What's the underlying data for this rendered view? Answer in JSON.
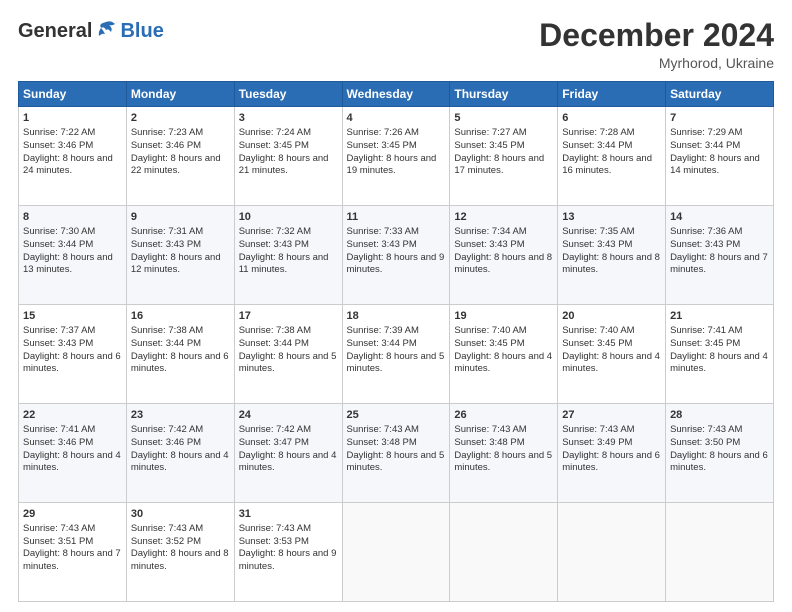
{
  "logo": {
    "general": "General",
    "blue": "Blue"
  },
  "header": {
    "month_title": "December 2024",
    "subtitle": "Myrhorod, Ukraine"
  },
  "calendar": {
    "days_of_week": [
      "Sunday",
      "Monday",
      "Tuesday",
      "Wednesday",
      "Thursday",
      "Friday",
      "Saturday"
    ],
    "weeks": [
      [
        {
          "day": "1",
          "sunrise": "Sunrise: 7:22 AM",
          "sunset": "Sunset: 3:46 PM",
          "daylight": "Daylight: 8 hours and 24 minutes."
        },
        {
          "day": "2",
          "sunrise": "Sunrise: 7:23 AM",
          "sunset": "Sunset: 3:46 PM",
          "daylight": "Daylight: 8 hours and 22 minutes."
        },
        {
          "day": "3",
          "sunrise": "Sunrise: 7:24 AM",
          "sunset": "Sunset: 3:45 PM",
          "daylight": "Daylight: 8 hours and 21 minutes."
        },
        {
          "day": "4",
          "sunrise": "Sunrise: 7:26 AM",
          "sunset": "Sunset: 3:45 PM",
          "daylight": "Daylight: 8 hours and 19 minutes."
        },
        {
          "day": "5",
          "sunrise": "Sunrise: 7:27 AM",
          "sunset": "Sunset: 3:45 PM",
          "daylight": "Daylight: 8 hours and 17 minutes."
        },
        {
          "day": "6",
          "sunrise": "Sunrise: 7:28 AM",
          "sunset": "Sunset: 3:44 PM",
          "daylight": "Daylight: 8 hours and 16 minutes."
        },
        {
          "day": "7",
          "sunrise": "Sunrise: 7:29 AM",
          "sunset": "Sunset: 3:44 PM",
          "daylight": "Daylight: 8 hours and 14 minutes."
        }
      ],
      [
        {
          "day": "8",
          "sunrise": "Sunrise: 7:30 AM",
          "sunset": "Sunset: 3:44 PM",
          "daylight": "Daylight: 8 hours and 13 minutes."
        },
        {
          "day": "9",
          "sunrise": "Sunrise: 7:31 AM",
          "sunset": "Sunset: 3:43 PM",
          "daylight": "Daylight: 8 hours and 12 minutes."
        },
        {
          "day": "10",
          "sunrise": "Sunrise: 7:32 AM",
          "sunset": "Sunset: 3:43 PM",
          "daylight": "Daylight: 8 hours and 11 minutes."
        },
        {
          "day": "11",
          "sunrise": "Sunrise: 7:33 AM",
          "sunset": "Sunset: 3:43 PM",
          "daylight": "Daylight: 8 hours and 9 minutes."
        },
        {
          "day": "12",
          "sunrise": "Sunrise: 7:34 AM",
          "sunset": "Sunset: 3:43 PM",
          "daylight": "Daylight: 8 hours and 8 minutes."
        },
        {
          "day": "13",
          "sunrise": "Sunrise: 7:35 AM",
          "sunset": "Sunset: 3:43 PM",
          "daylight": "Daylight: 8 hours and 8 minutes."
        },
        {
          "day": "14",
          "sunrise": "Sunrise: 7:36 AM",
          "sunset": "Sunset: 3:43 PM",
          "daylight": "Daylight: 8 hours and 7 minutes."
        }
      ],
      [
        {
          "day": "15",
          "sunrise": "Sunrise: 7:37 AM",
          "sunset": "Sunset: 3:43 PM",
          "daylight": "Daylight: 8 hours and 6 minutes."
        },
        {
          "day": "16",
          "sunrise": "Sunrise: 7:38 AM",
          "sunset": "Sunset: 3:44 PM",
          "daylight": "Daylight: 8 hours and 6 minutes."
        },
        {
          "day": "17",
          "sunrise": "Sunrise: 7:38 AM",
          "sunset": "Sunset: 3:44 PM",
          "daylight": "Daylight: 8 hours and 5 minutes."
        },
        {
          "day": "18",
          "sunrise": "Sunrise: 7:39 AM",
          "sunset": "Sunset: 3:44 PM",
          "daylight": "Daylight: 8 hours and 5 minutes."
        },
        {
          "day": "19",
          "sunrise": "Sunrise: 7:40 AM",
          "sunset": "Sunset: 3:45 PM",
          "daylight": "Daylight: 8 hours and 4 minutes."
        },
        {
          "day": "20",
          "sunrise": "Sunrise: 7:40 AM",
          "sunset": "Sunset: 3:45 PM",
          "daylight": "Daylight: 8 hours and 4 minutes."
        },
        {
          "day": "21",
          "sunrise": "Sunrise: 7:41 AM",
          "sunset": "Sunset: 3:45 PM",
          "daylight": "Daylight: 8 hours and 4 minutes."
        }
      ],
      [
        {
          "day": "22",
          "sunrise": "Sunrise: 7:41 AM",
          "sunset": "Sunset: 3:46 PM",
          "daylight": "Daylight: 8 hours and 4 minutes."
        },
        {
          "day": "23",
          "sunrise": "Sunrise: 7:42 AM",
          "sunset": "Sunset: 3:46 PM",
          "daylight": "Daylight: 8 hours and 4 minutes."
        },
        {
          "day": "24",
          "sunrise": "Sunrise: 7:42 AM",
          "sunset": "Sunset: 3:47 PM",
          "daylight": "Daylight: 8 hours and 4 minutes."
        },
        {
          "day": "25",
          "sunrise": "Sunrise: 7:43 AM",
          "sunset": "Sunset: 3:48 PM",
          "daylight": "Daylight: 8 hours and 5 minutes."
        },
        {
          "day": "26",
          "sunrise": "Sunrise: 7:43 AM",
          "sunset": "Sunset: 3:48 PM",
          "daylight": "Daylight: 8 hours and 5 minutes."
        },
        {
          "day": "27",
          "sunrise": "Sunrise: 7:43 AM",
          "sunset": "Sunset: 3:49 PM",
          "daylight": "Daylight: 8 hours and 6 minutes."
        },
        {
          "day": "28",
          "sunrise": "Sunrise: 7:43 AM",
          "sunset": "Sunset: 3:50 PM",
          "daylight": "Daylight: 8 hours and 6 minutes."
        }
      ],
      [
        {
          "day": "29",
          "sunrise": "Sunrise: 7:43 AM",
          "sunset": "Sunset: 3:51 PM",
          "daylight": "Daylight: 8 hours and 7 minutes."
        },
        {
          "day": "30",
          "sunrise": "Sunrise: 7:43 AM",
          "sunset": "Sunset: 3:52 PM",
          "daylight": "Daylight: 8 hours and 8 minutes."
        },
        {
          "day": "31",
          "sunrise": "Sunrise: 7:43 AM",
          "sunset": "Sunset: 3:53 PM",
          "daylight": "Daylight: 8 hours and 9 minutes."
        },
        null,
        null,
        null,
        null
      ]
    ]
  }
}
